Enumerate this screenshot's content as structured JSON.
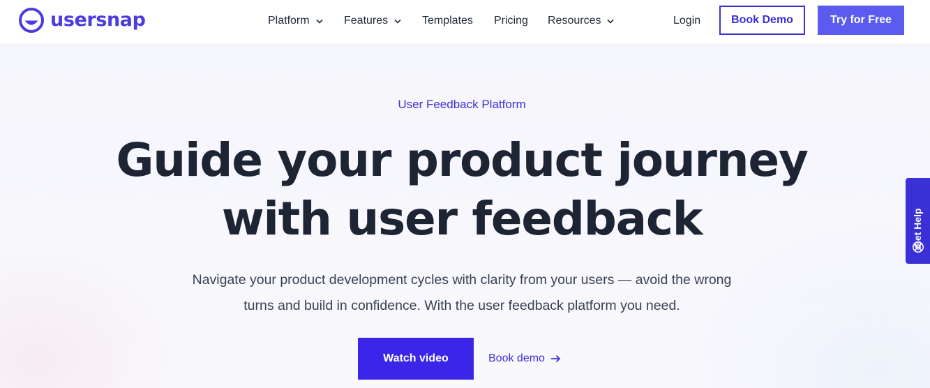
{
  "brand": {
    "name": "usersnap",
    "color": "#4a3ce0"
  },
  "header": {
    "nav": [
      {
        "label": "Platform",
        "has_dropdown": true
      },
      {
        "label": "Features",
        "has_dropdown": true
      },
      {
        "label": "Templates",
        "has_dropdown": false
      },
      {
        "label": "Pricing",
        "has_dropdown": false
      },
      {
        "label": "Resources",
        "has_dropdown": true
      }
    ],
    "login_label": "Login",
    "book_demo_label": "Book Demo",
    "try_free_label": "Try for Free"
  },
  "hero": {
    "eyebrow": "User Feedback Platform",
    "headline_line1": "Guide your product journey",
    "headline_line2": "with user feedback",
    "subtext_line1": "Navigate your product development cycles with clarity from your users — avoid the wrong",
    "subtext_line2": "turns and build in confidence. With the user feedback platform you need.",
    "watch_video_label": "Watch video",
    "book_demo_link_label": "Book demo"
  },
  "help_tab": {
    "label": "Get Help",
    "icon": "lifebuoy-icon"
  },
  "colors": {
    "accent": "#3b2fd6",
    "cta": "#3b25e8",
    "try_button": "#5b5bf0",
    "heading": "#1d2433"
  }
}
